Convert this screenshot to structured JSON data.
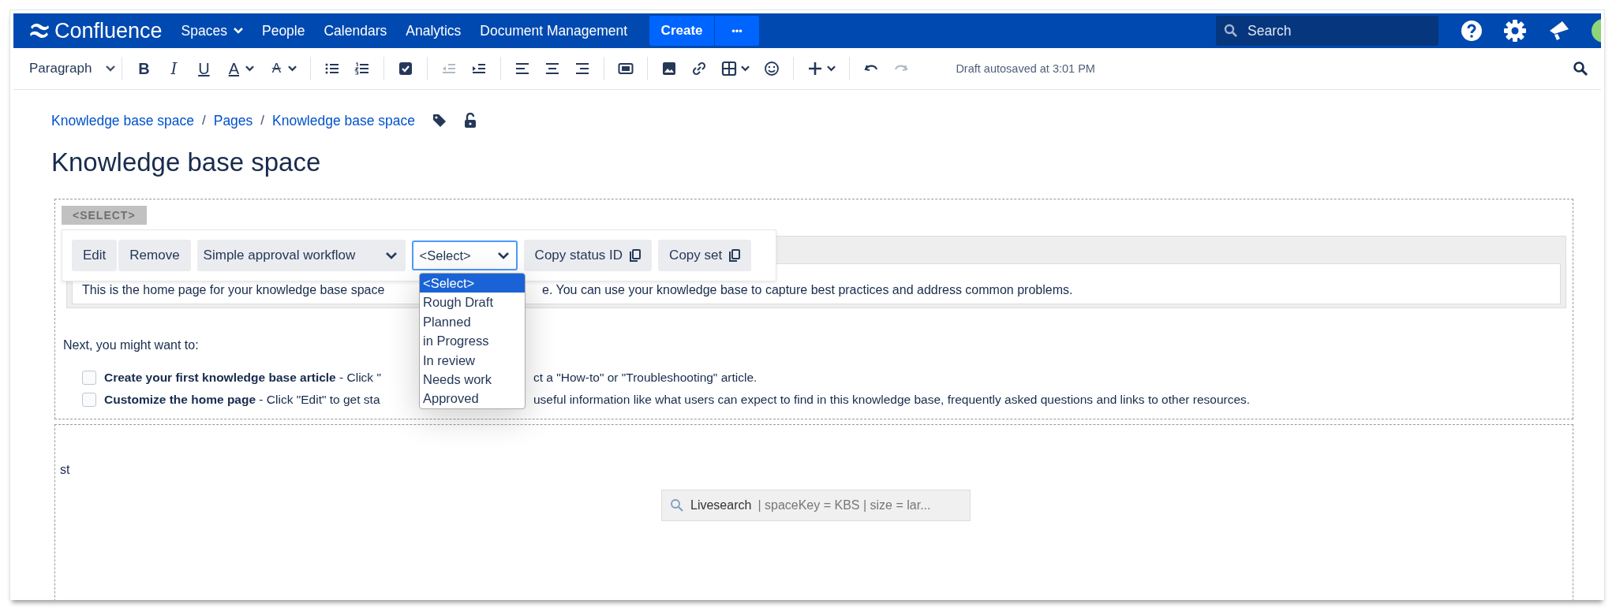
{
  "header": {
    "logo": "Confluence",
    "nav": [
      {
        "label": "Spaces",
        "dropdown": true
      },
      {
        "label": "People",
        "dropdown": false
      },
      {
        "label": "Calendars",
        "dropdown": false
      },
      {
        "label": "Analytics",
        "dropdown": false
      },
      {
        "label": "Document Management",
        "dropdown": false
      }
    ],
    "create": "Create",
    "more": "•••",
    "search": {
      "placeholder": "Search"
    },
    "icons": [
      {
        "kind": "help"
      },
      {
        "kind": "settings"
      },
      {
        "kind": "notifications"
      }
    ]
  },
  "toolbar": {
    "style": "Paragraph",
    "groups": [
      [
        {
          "kind": "bold",
          "glyph": "B",
          "caret": false,
          "disabled": false
        },
        {
          "kind": "italic",
          "glyph": "I",
          "caret": false,
          "disabled": false
        },
        {
          "kind": "underline",
          "glyph": "U",
          "caret": false,
          "disabled": false
        },
        {
          "kind": "text-color",
          "glyph": "A",
          "caret": true,
          "disabled": false
        },
        {
          "kind": "clear-format",
          "glyph": "A",
          "caret": true,
          "disabled": false
        }
      ],
      [
        {
          "kind": "bullet-list",
          "caret": false,
          "disabled": false
        },
        {
          "kind": "numbered-list",
          "caret": false,
          "disabled": false
        }
      ],
      [
        {
          "kind": "task",
          "caret": false,
          "disabled": false
        }
      ],
      [
        {
          "kind": "outdent",
          "caret": false,
          "disabled": true
        },
        {
          "kind": "indent",
          "caret": false,
          "disabled": false
        }
      ],
      [
        {
          "kind": "align-left",
          "caret": false,
          "disabled": false
        },
        {
          "kind": "align-center",
          "caret": false,
          "disabled": false
        },
        {
          "kind": "align-right",
          "caret": false,
          "disabled": false
        }
      ],
      [
        {
          "kind": "layout",
          "caret": false,
          "disabled": false
        }
      ],
      [
        {
          "kind": "image",
          "caret": false,
          "disabled": false
        },
        {
          "kind": "link",
          "caret": false,
          "disabled": false
        },
        {
          "kind": "table",
          "caret": true,
          "disabled": false
        },
        {
          "kind": "emoji",
          "caret": false,
          "disabled": false
        }
      ],
      [
        {
          "kind": "insert",
          "caret": true,
          "disabled": false
        }
      ],
      [
        {
          "kind": "undo",
          "caret": false,
          "disabled": false
        },
        {
          "kind": "redo",
          "caret": false,
          "disabled": true
        }
      ]
    ],
    "autosave": "Draft autosaved at 3:01 PM"
  },
  "breadcrumbs": {
    "items": [
      "Knowledge base space",
      "Pages",
      "Knowledge base space"
    ],
    "separator": "/"
  },
  "title": "Knowledge base space",
  "macro": {
    "tag": "<SELECT>",
    "buttons": [
      "Edit",
      "Remove"
    ],
    "workflow": "Simple approval workflow",
    "status_select": {
      "value": "<Select>",
      "options": [
        {
          "label": "<Select>",
          "selected": true
        },
        {
          "label": "Rough Draft",
          "selected": false
        },
        {
          "label": "Planned",
          "selected": false
        },
        {
          "label": "in Progress",
          "selected": false
        },
        {
          "label": "In review",
          "selected": false
        },
        {
          "label": "Needs work",
          "selected": false
        },
        {
          "label": "Approved",
          "selected": false
        }
      ]
    },
    "copy_buttons": [
      "Copy status ID",
      "Copy set"
    ],
    "info_text": [
      "This is the home page for your knowledge base space",
      "e. You can use your knowledge base to capture best practices and address common problems."
    ],
    "next": "Next, you might want to:",
    "tasks": [
      {
        "checked": false,
        "parts": [
          "**Create your first knowledge base article** - Click \"",
          "ct a \"How-to\" or \"Troubleshooting\" article."
        ]
      },
      {
        "checked": false,
        "parts": [
          "**Customize the home page** - Click \"Edit\" to get sta",
          "useful information like what users can expect to find in this knowledge base, frequently asked questions and links to other resources."
        ]
      }
    ]
  },
  "second_block": {
    "text": "st",
    "livesearch": {
      "name": "Livesearch",
      "params": "| spaceKey = KBS | size = lar..."
    }
  }
}
